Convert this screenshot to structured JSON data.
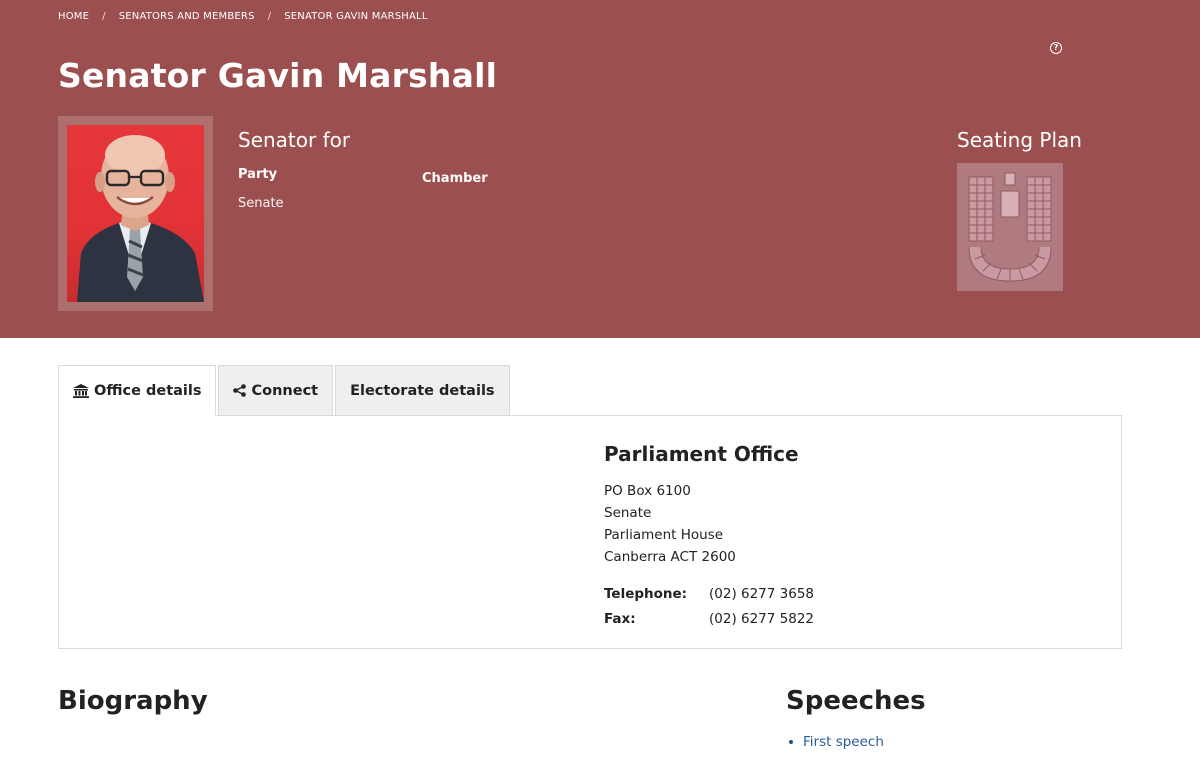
{
  "breadcrumb": {
    "items": [
      "HOME",
      "SENATORS AND MEMBERS",
      "SENATOR GAVIN MARSHALL"
    ],
    "separator": "/"
  },
  "header": {
    "title": "Senator Gavin Marshall",
    "senator_for": "Senator for",
    "party_label": "Party",
    "party_value": "Senate",
    "chamber_label": "Chamber",
    "seating_plan_title": "Seating Plan",
    "help_icon": "question-circle-icon"
  },
  "tabs": [
    {
      "label": "Office details",
      "icon": "building-icon",
      "active": true
    },
    {
      "label": "Connect",
      "icon": "share-icon",
      "active": false
    },
    {
      "label": "Electorate details",
      "icon": "",
      "active": false
    }
  ],
  "office": {
    "title": "Parliament Office",
    "address_lines": [
      "PO Box 6100",
      "Senate",
      "Parliament House",
      "Canberra ACT 2600"
    ],
    "telephone_label": "Telephone:",
    "telephone_value": "(02) 6277 3658",
    "fax_label": "Fax:",
    "fax_value": "(02) 6277 5822"
  },
  "biography": {
    "title": "Biography"
  },
  "speeches": {
    "title": "Speeches",
    "items": [
      "First speech"
    ]
  },
  "colors": {
    "hero_bg": "#9c4f4f",
    "link": "#2c5c99",
    "photo_bg": "#e13336"
  }
}
